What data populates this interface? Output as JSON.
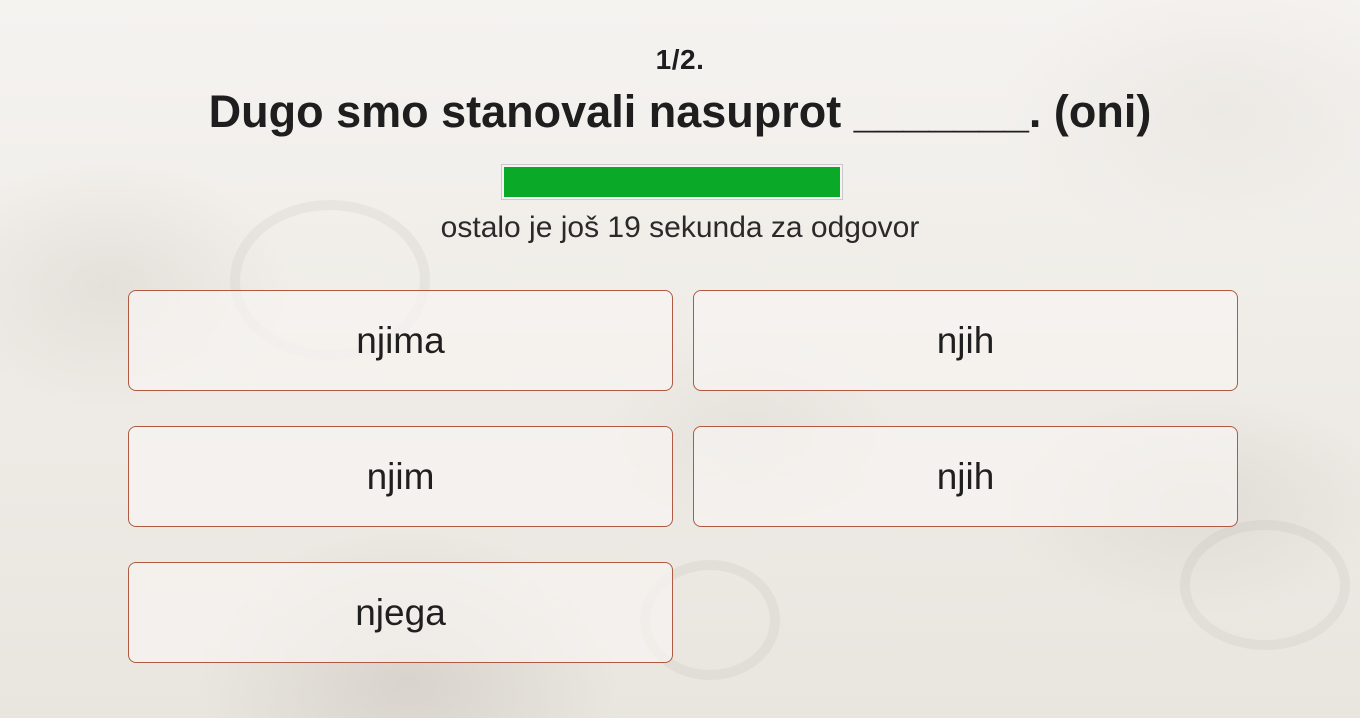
{
  "quiz": {
    "counter": "1/2.",
    "question": "Dugo smo stanovali nasuprot _______. (oni)",
    "timer": {
      "remaining_fraction": 1.0,
      "fill_color": "#0aa928",
      "text": "ostalo je još 19 sekunda za odgovor"
    },
    "answers": [
      {
        "label": "njima"
      },
      {
        "label": "njih"
      },
      {
        "label": "njim"
      },
      {
        "label": "njih"
      },
      {
        "label": "njega"
      }
    ],
    "answer_border_color": "#b05a44"
  }
}
